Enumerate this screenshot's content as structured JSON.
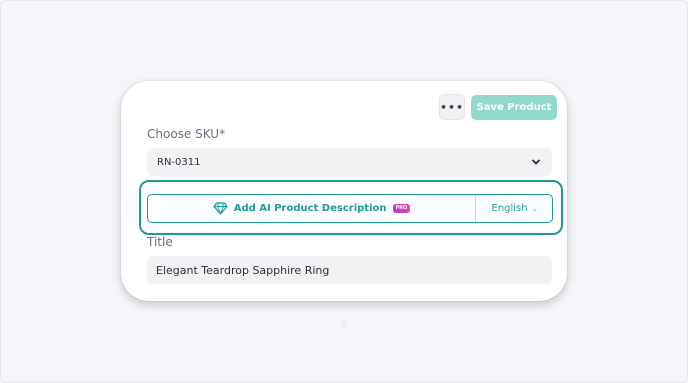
{
  "toolbar": {
    "more_label": "•••",
    "save_label": "Save Product"
  },
  "sku": {
    "label": "Choose SKU*",
    "value": "RN-0311"
  },
  "ai_description": {
    "label": "Add AI Product Description",
    "badge": "PRO",
    "language": "English",
    "language_chevron": "⌄"
  },
  "title": {
    "label": "Title",
    "value": "Elegant Teardrop Sapphire Ring"
  },
  "colors": {
    "accent": "#1d9a95",
    "save_button": "#93d9cb",
    "pro_badge_start": "#a93de0",
    "pro_badge_end": "#e5479b"
  },
  "icons": {
    "more": "more-horizontal-icon",
    "sku_dropdown": "chevron-down-icon",
    "ai": "gem-icon",
    "language_dropdown": "chevron-down-icon"
  }
}
